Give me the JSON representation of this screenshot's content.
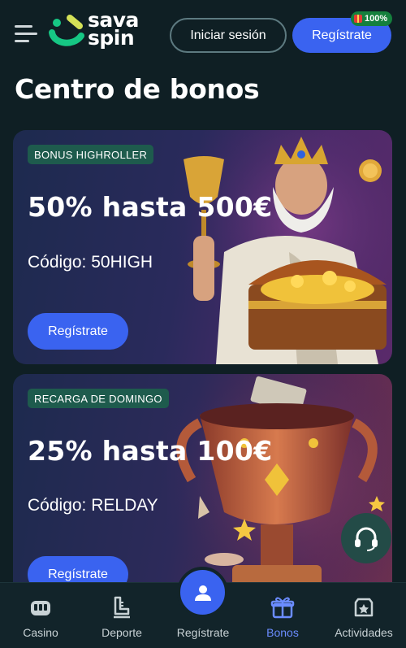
{
  "header": {
    "logo_line1": "sava",
    "logo_line2": "spin",
    "login_label": "Iniciar sesión",
    "register_label": "Regístrate",
    "register_badge": "100%"
  },
  "page_title": "Centro de bonos",
  "bonuses": [
    {
      "tag": "BONUS HIGHROLLER",
      "offer": "50% hasta 500€",
      "code": "Código: 50HIGH",
      "button": "Regístrate"
    },
    {
      "tag": "RECARGA DE DOMINGO",
      "offer": "25% hasta 100€",
      "code": "Código: RELDAY",
      "button": "Regístrate"
    }
  ],
  "bottom_nav": [
    {
      "label": "Casino",
      "icon": "casino-icon"
    },
    {
      "label": "Deporte",
      "icon": "sport-icon"
    },
    {
      "label": "Regístrate",
      "icon": "user-icon"
    },
    {
      "label": "Bonos",
      "icon": "gift-icon"
    },
    {
      "label": "Actividades",
      "icon": "activities-icon"
    }
  ],
  "colors": {
    "background": "#0f1f24",
    "accent": "#3a63f0",
    "logo_green": "#16c784",
    "tag_bg": "#1e5b4d",
    "active_nav": "#6b8cff"
  }
}
